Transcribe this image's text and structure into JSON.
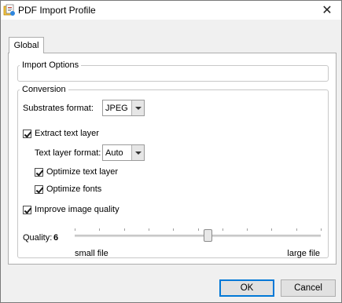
{
  "window": {
    "title": "PDF Import Profile",
    "close_glyph": "✕"
  },
  "tabs": [
    {
      "label": "Global",
      "selected": true
    }
  ],
  "import_options": {
    "legend": "Import Options"
  },
  "conversion": {
    "legend": "Conversion",
    "substrates_format": {
      "label": "Substrates format:",
      "value": "JPEG"
    },
    "extract_text_layer": {
      "label": "Extract text layer",
      "checked": true
    },
    "text_layer_format": {
      "label": "Text layer format:",
      "value": "Auto"
    },
    "optimize_text_layer": {
      "label": "Optimize text layer",
      "checked": true
    },
    "optimize_fonts": {
      "label": "Optimize fonts",
      "checked": true
    },
    "improve_image_quality": {
      "label": "Improve image quality",
      "checked": true
    },
    "quality": {
      "label": "Quality:",
      "value": "6",
      "min_label": "small file",
      "max_label": "large file",
      "slider_fraction": 0.54
    }
  },
  "buttons": {
    "ok": "OK",
    "cancel": "Cancel"
  },
  "colors": {
    "default_button_border": "#0078d7"
  }
}
